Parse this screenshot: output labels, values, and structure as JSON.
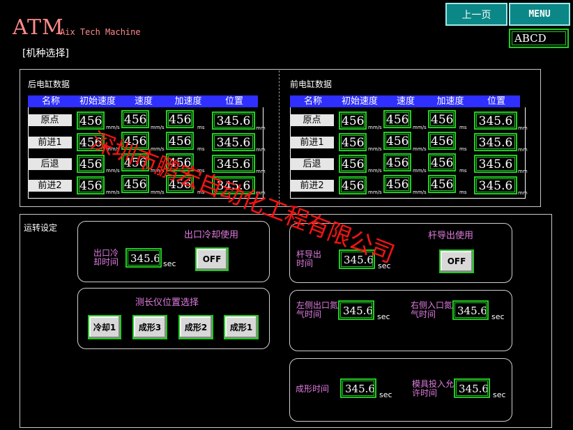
{
  "header": {
    "logo": "ATM",
    "logo_sub": "Aix Tech Machine",
    "page_title": "[机种选择]",
    "prev_button": "上一页",
    "menu_button": "MENU",
    "user_field": "ABCD"
  },
  "rear_cylinder": {
    "title": "后电缸数据",
    "headers": [
      "名称",
      "初始速度",
      "速度",
      "加速度",
      "位置"
    ],
    "rows": [
      {
        "label": "原点",
        "init_speed": "456",
        "speed": "456",
        "accel": "456",
        "position": "345.6"
      },
      {
        "label": "前进1",
        "init_speed": "456",
        "speed": "456",
        "accel": "456",
        "position": "345.6"
      },
      {
        "label": "后退",
        "init_speed": "456",
        "speed": "456",
        "accel": "456",
        "position": "345.6"
      },
      {
        "label": "前进2",
        "init_speed": "456",
        "speed": "456",
        "accel": "456",
        "position": "345.6"
      }
    ]
  },
  "front_cylinder": {
    "title": "前电缸数据",
    "headers": [
      "名称",
      "初始速度",
      "速度",
      "加速度",
      "位置"
    ],
    "rows": [
      {
        "label": "原点",
        "init_speed": "456",
        "speed": "456",
        "accel": "456",
        "position": "345.6"
      },
      {
        "label": "前进1",
        "init_speed": "456",
        "speed": "456",
        "accel": "456",
        "position": "345.6"
      },
      {
        "label": "后退",
        "init_speed": "456",
        "speed": "456",
        "accel": "456",
        "position": "345.6"
      },
      {
        "label": "前进2",
        "init_speed": "456",
        "speed": "456",
        "accel": "456",
        "position": "345.6"
      }
    ]
  },
  "units": {
    "speed": "mm/s",
    "accel": "ms",
    "position": "mm",
    "time": "sec"
  },
  "running": {
    "title": "运转设定",
    "outlet_cooling_use": "出口冷却使用",
    "outlet_cooling_time_label": "出口冷却时间",
    "outlet_cooling_time": "345.6",
    "outlet_cooling_button": "OFF",
    "gauge_position_title": "测长仪位置选择",
    "gauge_buttons": [
      "冷却1",
      "成形3",
      "成形2",
      "成形1"
    ],
    "guide_rod_use": "杆导出使用",
    "guide_rod_time_label": "杆导出时间",
    "guide_rod_time": "345.6",
    "guide_rod_button": "OFF",
    "left_outlet_label": "左侧出口氮气时间",
    "left_outlet_time": "345.6",
    "right_inlet_label": "右侧入口氮气时间",
    "right_inlet_time": "345.6",
    "forming_time_label": "成形时间",
    "forming_time": "345.6",
    "mold_insert_label": "模具投入允许时间",
    "mold_insert_time": "345.6"
  },
  "watermark": "深圳市鹏宏自动化工程有限公司",
  "colors": {
    "background": "#000000",
    "header_button": "#0c8787",
    "table_header": "#2f2fff",
    "field_border": "#22cc22",
    "label_magenta": "#e07ce0",
    "logo": "#ff8a8a",
    "watermark": "#ff1515"
  }
}
